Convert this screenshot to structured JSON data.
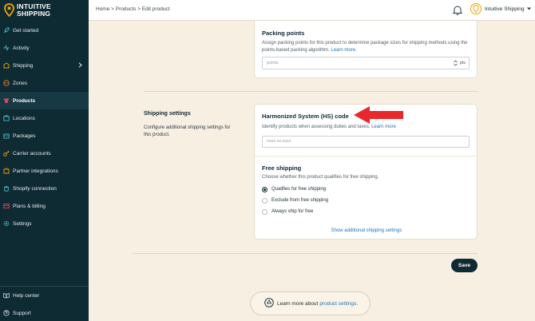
{
  "brand": {
    "line1": "INTUITIVE",
    "line2": "SHIPPING"
  },
  "sidebar": {
    "items": [
      {
        "label": "Get started",
        "icon": "rocket-icon"
      },
      {
        "label": "Activity",
        "icon": "activity-icon"
      },
      {
        "label": "Shipping",
        "icon": "shipping-icon",
        "has_children": true
      },
      {
        "label": "Zones",
        "icon": "globe-icon"
      },
      {
        "label": "Products",
        "icon": "shirt-icon",
        "active": true
      },
      {
        "label": "Locations",
        "icon": "pin-icon"
      },
      {
        "label": "Packages",
        "icon": "package-icon"
      },
      {
        "label": "Carrier accounts",
        "icon": "key-icon"
      },
      {
        "label": "Partner integrations",
        "icon": "puzzle-icon"
      },
      {
        "label": "Shopify connection",
        "icon": "shopify-icon"
      },
      {
        "label": "Plans & billing",
        "icon": "billing-icon"
      },
      {
        "label": "Settings",
        "icon": "gear-icon"
      }
    ],
    "bottom_items": [
      {
        "label": "Help center",
        "icon": "book-icon"
      },
      {
        "label": "Support",
        "icon": "help-icon"
      }
    ]
  },
  "header": {
    "breadcrumb": "Home > Products > Edit product",
    "user_name": "Intuitive Shipping"
  },
  "packing": {
    "title": "Packing points",
    "desc": "Assign packing points for this product to determine package sizes for shipping methods using the points-based packing algorithm.",
    "link": "Learn more.",
    "placeholder": "points",
    "unit": "pts"
  },
  "shipping_settings": {
    "title": "Shipping settings",
    "desc": "Configure additional shipping settings for this product."
  },
  "hs": {
    "title": "Harmonized System (HS) code",
    "desc": "Identify products when assessing duties and taxes.",
    "link": "Learn more",
    "placeholder": "xxxx.xx.xxxx"
  },
  "free_shipping": {
    "title": "Free shipping",
    "desc": "Choose whether this product qualifies for free shipping.",
    "options": [
      {
        "label": "Qualifies for free shipping",
        "checked": true
      },
      {
        "label": "Exclude from free shipping",
        "checked": false
      },
      {
        "label": "Always ship for free",
        "checked": false
      }
    ],
    "more_link": "Show additional shipping settings"
  },
  "save_label": "Save",
  "learn_more": {
    "prefix": "Learn more about",
    "link": "product settings."
  },
  "colors": {
    "sidebar_bg": "#0e2a33",
    "accent": "#f0a500",
    "annotation_arrow": "#e8282b",
    "link": "#1f74b5"
  }
}
